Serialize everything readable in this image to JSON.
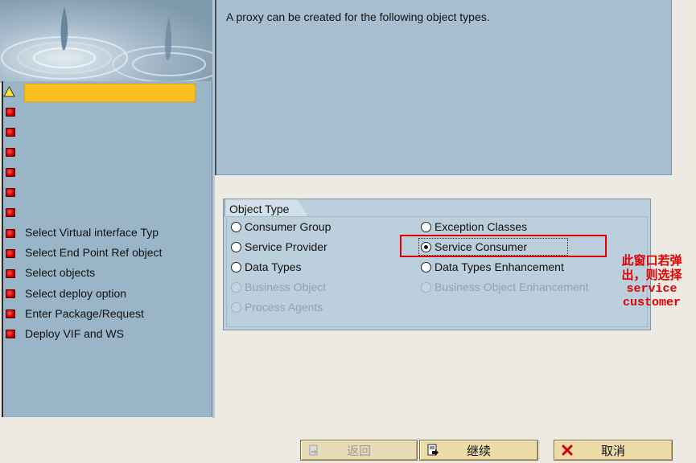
{
  "info": {
    "text": "A proxy can be created for the following object types."
  },
  "steps": [
    {
      "label": "",
      "status": "warning"
    },
    {
      "label": "",
      "status": "error"
    },
    {
      "label": "",
      "status": "error"
    },
    {
      "label": "",
      "status": "error"
    },
    {
      "label": "",
      "status": "error"
    },
    {
      "label": "",
      "status": "error"
    },
    {
      "label": "",
      "status": "error"
    },
    {
      "label": "Select Virtual interface Typ",
      "status": "error"
    },
    {
      "label": "Select End Point Ref object",
      "status": "error"
    },
    {
      "label": "Select objects",
      "status": "error"
    },
    {
      "label": "Select deploy option",
      "status": "error"
    },
    {
      "label": "Enter Package/Request",
      "status": "error"
    },
    {
      "label": "Deploy VIF and WS",
      "status": "error"
    }
  ],
  "object_type": {
    "title": "Object Type",
    "options": [
      {
        "label": "Consumer Group",
        "checked": false,
        "enabled": true
      },
      {
        "label": "Exception Classes",
        "checked": false,
        "enabled": true
      },
      {
        "label": "Service Provider",
        "checked": false,
        "enabled": true
      },
      {
        "label": "Service Consumer",
        "checked": true,
        "enabled": true
      },
      {
        "label": "Data Types",
        "checked": false,
        "enabled": true
      },
      {
        "label": "Data Types Enhancement",
        "checked": false,
        "enabled": true
      },
      {
        "label": "Business Object",
        "checked": false,
        "enabled": false
      },
      {
        "label": "Business Object Enhancement",
        "checked": false,
        "enabled": false
      },
      {
        "label": "Process Agents",
        "checked": false,
        "enabled": false
      }
    ]
  },
  "annotation": {
    "line1": "此窗口若弹",
    "line2": "出，则选择",
    "line3": "service",
    "line4": "customer",
    "color": "#e00000"
  },
  "buttons": {
    "back": "返回",
    "continue": "继续",
    "cancel": "取消"
  },
  "colors": {
    "highlight": "#f9c01d",
    "panel": "#9ab5c8",
    "group": "#bccfdc",
    "button": "#eddcaa"
  }
}
